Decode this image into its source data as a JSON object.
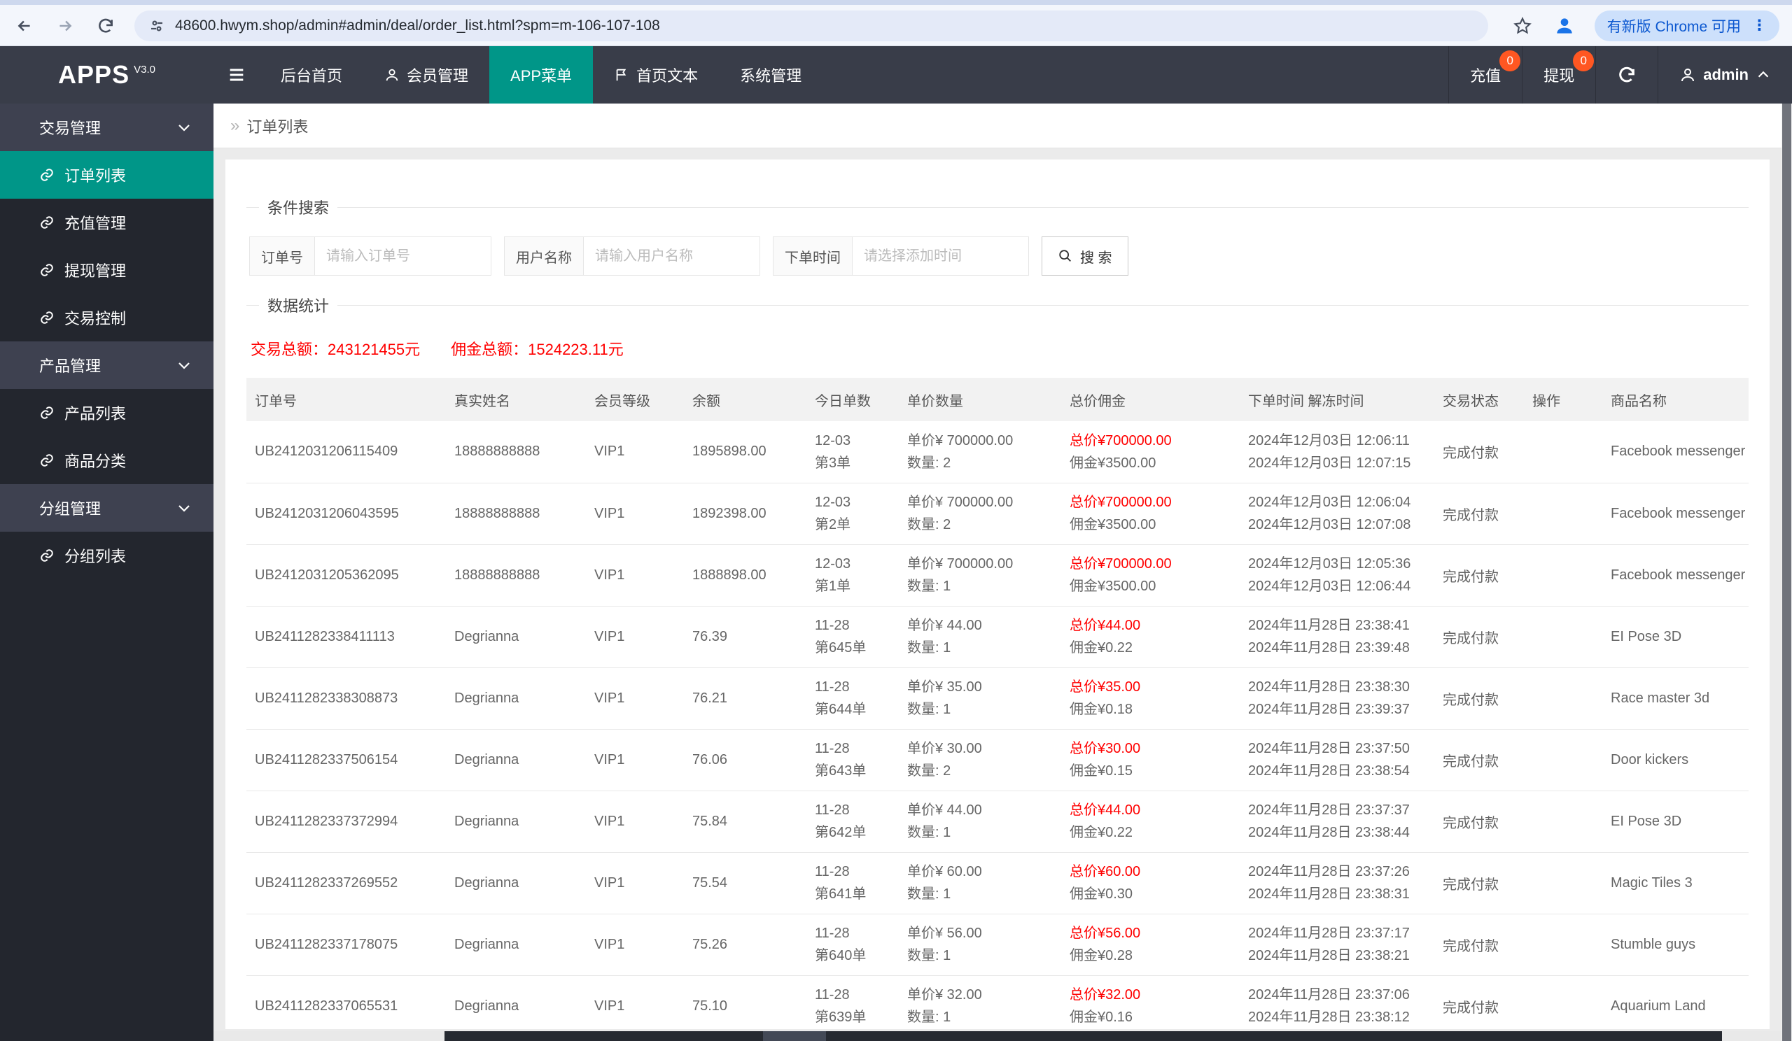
{
  "browser": {
    "url": "48600.hwym.shop/admin#admin/deal/order_list.html?spm=m-106-107-108",
    "update_button": "有新版 Chrome 可用"
  },
  "header": {
    "logo": "APPS",
    "logo_version": "V3.0",
    "nav": [
      {
        "label": "后台首页",
        "icon": ""
      },
      {
        "label": "会员管理",
        "icon": "person-icon"
      },
      {
        "label": "APP菜单",
        "icon": "",
        "active": true
      },
      {
        "label": "首页文本",
        "icon": "flag-icon"
      },
      {
        "label": "系统管理",
        "icon": ""
      }
    ],
    "right": {
      "recharge_label": "充值",
      "recharge_badge": "0",
      "withdraw_label": "提现",
      "withdraw_badge": "0",
      "username": "admin"
    }
  },
  "sidebar": {
    "groups": [
      {
        "label": "交易管理",
        "items": [
          {
            "label": "订单列表",
            "active": true
          },
          {
            "label": "充值管理"
          },
          {
            "label": "提现管理"
          },
          {
            "label": "交易控制"
          }
        ]
      },
      {
        "label": "产品管理",
        "items": [
          {
            "label": "产品列表"
          },
          {
            "label": "商品分类"
          }
        ]
      },
      {
        "label": "分组管理",
        "items": [
          {
            "label": "分组列表"
          }
        ]
      }
    ]
  },
  "breadcrumb": {
    "separator": "»",
    "title": "订单列表"
  },
  "search": {
    "legend": "条件搜索",
    "fields": [
      {
        "label": "订单号",
        "placeholder": "请输入订单号"
      },
      {
        "label": "用户名称",
        "placeholder": "请输入用户名称"
      },
      {
        "label": "下单时间",
        "placeholder": "请选择添加时间"
      }
    ],
    "button_label": "搜 索"
  },
  "stats": {
    "legend": "数据统计",
    "total_trade": "交易总额：243121455元",
    "total_commission": "佣金总额：1524223.11元"
  },
  "table": {
    "columns": [
      "订单号",
      "真实姓名",
      "会员等级",
      "余额",
      "今日单数",
      "单价数量",
      "总价佣金",
      "下单时间 解冻时间",
      "交易状态",
      "操作",
      "商品名称"
    ],
    "rows": [
      {
        "order_no": "UB2412031206115409",
        "real_name": "18888888888",
        "level": "VIP1",
        "balance": "1895898.00",
        "day": "12-03",
        "seq": "第3单",
        "unit_price": "单价¥ 700000.00",
        "quantity": "数量: 2",
        "total": "总价¥700000.00",
        "commission": "佣金¥3500.00",
        "time_order": "2024年12月03日 12:06:11",
        "time_unfreeze": "2024年12月03日 12:07:15",
        "status": "完成付款",
        "product": "Facebook messenger"
      },
      {
        "order_no": "UB2412031206043595",
        "real_name": "18888888888",
        "level": "VIP1",
        "balance": "1892398.00",
        "day": "12-03",
        "seq": "第2单",
        "unit_price": "单价¥ 700000.00",
        "quantity": "数量: 2",
        "total": "总价¥700000.00",
        "commission": "佣金¥3500.00",
        "time_order": "2024年12月03日 12:06:04",
        "time_unfreeze": "2024年12月03日 12:07:08",
        "status": "完成付款",
        "product": "Facebook messenger"
      },
      {
        "order_no": "UB2412031205362095",
        "real_name": "18888888888",
        "level": "VIP1",
        "balance": "1888898.00",
        "day": "12-03",
        "seq": "第1单",
        "unit_price": "单价¥ 700000.00",
        "quantity": "数量: 1",
        "total": "总价¥700000.00",
        "commission": "佣金¥3500.00",
        "time_order": "2024年12月03日 12:05:36",
        "time_unfreeze": "2024年12月03日 12:06:44",
        "status": "完成付款",
        "product": "Facebook messenger"
      },
      {
        "order_no": "UB2411282338411113",
        "real_name": "Degrianna",
        "level": "VIP1",
        "balance": "76.39",
        "day": "11-28",
        "seq": "第645单",
        "unit_price": "单价¥ 44.00",
        "quantity": "数量: 1",
        "total": "总价¥44.00",
        "commission": "佣金¥0.22",
        "time_order": "2024年11月28日 23:38:41",
        "time_unfreeze": "2024年11月28日 23:39:48",
        "status": "完成付款",
        "product": "EI Pose 3D"
      },
      {
        "order_no": "UB2411282338308873",
        "real_name": "Degrianna",
        "level": "VIP1",
        "balance": "76.21",
        "day": "11-28",
        "seq": "第644单",
        "unit_price": "单价¥ 35.00",
        "quantity": "数量: 1",
        "total": "总价¥35.00",
        "commission": "佣金¥0.18",
        "time_order": "2024年11月28日 23:38:30",
        "time_unfreeze": "2024年11月28日 23:39:37",
        "status": "完成付款",
        "product": "Race master 3d"
      },
      {
        "order_no": "UB2411282337506154",
        "real_name": "Degrianna",
        "level": "VIP1",
        "balance": "76.06",
        "day": "11-28",
        "seq": "第643单",
        "unit_price": "单价¥ 30.00",
        "quantity": "数量: 2",
        "total": "总价¥30.00",
        "commission": "佣金¥0.15",
        "time_order": "2024年11月28日 23:37:50",
        "time_unfreeze": "2024年11月28日 23:38:54",
        "status": "完成付款",
        "product": "Door kickers"
      },
      {
        "order_no": "UB2411282337372994",
        "real_name": "Degrianna",
        "level": "VIP1",
        "balance": "75.84",
        "day": "11-28",
        "seq": "第642单",
        "unit_price": "单价¥ 44.00",
        "quantity": "数量: 1",
        "total": "总价¥44.00",
        "commission": "佣金¥0.22",
        "time_order": "2024年11月28日 23:37:37",
        "time_unfreeze": "2024年11月28日 23:38:44",
        "status": "完成付款",
        "product": "EI Pose 3D"
      },
      {
        "order_no": "UB2411282337269552",
        "real_name": "Degrianna",
        "level": "VIP1",
        "balance": "75.54",
        "day": "11-28",
        "seq": "第641单",
        "unit_price": "单价¥ 60.00",
        "quantity": "数量: 1",
        "total": "总价¥60.00",
        "commission": "佣金¥0.30",
        "time_order": "2024年11月28日 23:37:26",
        "time_unfreeze": "2024年11月28日 23:38:31",
        "status": "完成付款",
        "product": "Magic Tiles 3"
      },
      {
        "order_no": "UB2411282337178075",
        "real_name": "Degrianna",
        "level": "VIP1",
        "balance": "75.26",
        "day": "11-28",
        "seq": "第640单",
        "unit_price": "单价¥ 56.00",
        "quantity": "数量: 1",
        "total": "总价¥56.00",
        "commission": "佣金¥0.28",
        "time_order": "2024年11月28日 23:37:17",
        "time_unfreeze": "2024年11月28日 23:38:21",
        "status": "完成付款",
        "product": "Stumble guys"
      },
      {
        "order_no": "UB2411282337065531",
        "real_name": "Degrianna",
        "level": "VIP1",
        "balance": "75.10",
        "day": "11-28",
        "seq": "第639单",
        "unit_price": "单价¥ 32.00",
        "quantity": "数量: 1",
        "total": "总价¥32.00",
        "commission": "佣金¥0.16",
        "time_order": "2024年11月28日 23:37:06",
        "time_unfreeze": "2024年11月28日 23:38:12",
        "status": "完成付款",
        "product": "Aquarium Land"
      }
    ]
  }
}
